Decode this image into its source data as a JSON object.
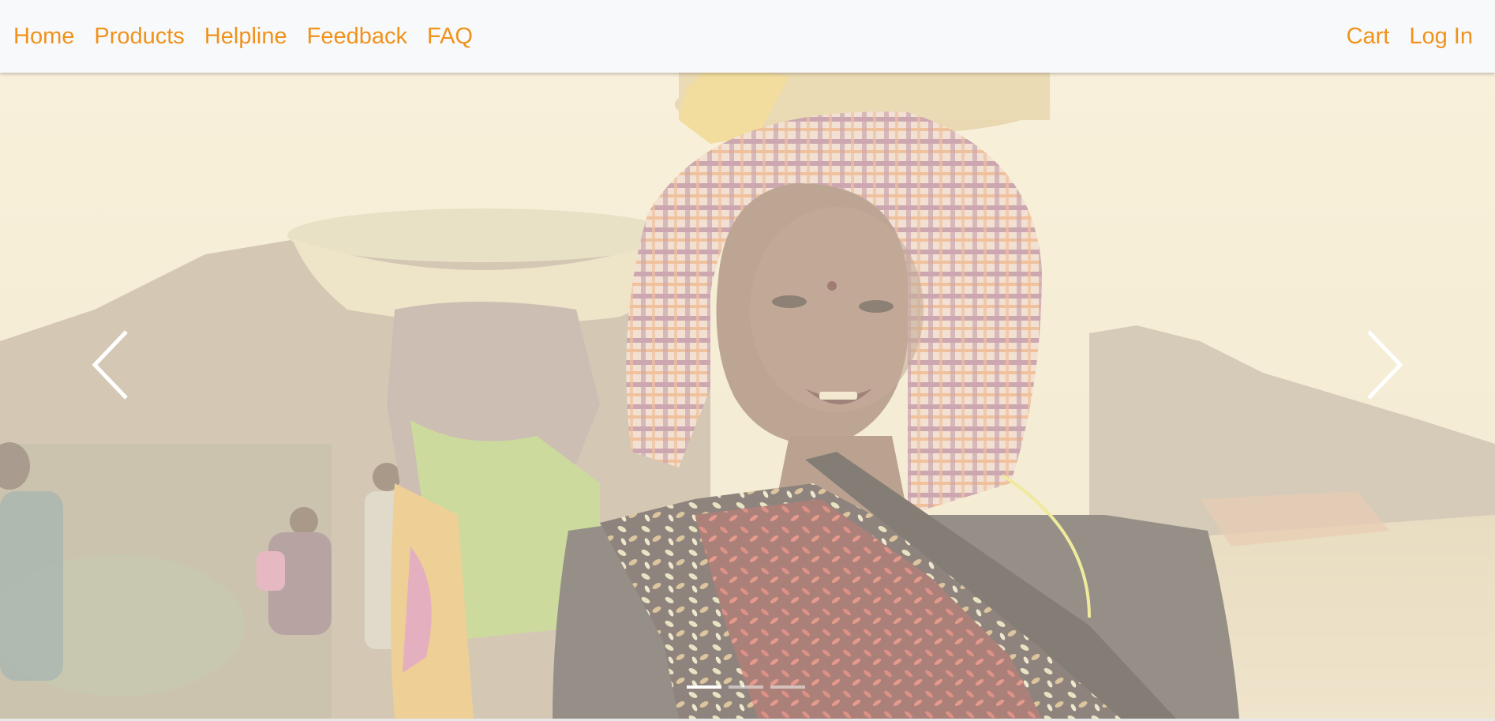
{
  "nav": {
    "left_links": [
      "Home",
      "Products",
      "Helpline",
      "Feedback",
      "FAQ"
    ],
    "right_links": [
      "Cart",
      "Log In"
    ]
  },
  "carousel": {
    "slide_count": 3,
    "active_index": 0,
    "prev_icon": "chevron-left-icon",
    "next_icon": "chevron-right-icon"
  },
  "colors": {
    "nav_link": "#f0921c",
    "nav_bg": "#f8f9fb",
    "overlay": "#fff8e6"
  }
}
